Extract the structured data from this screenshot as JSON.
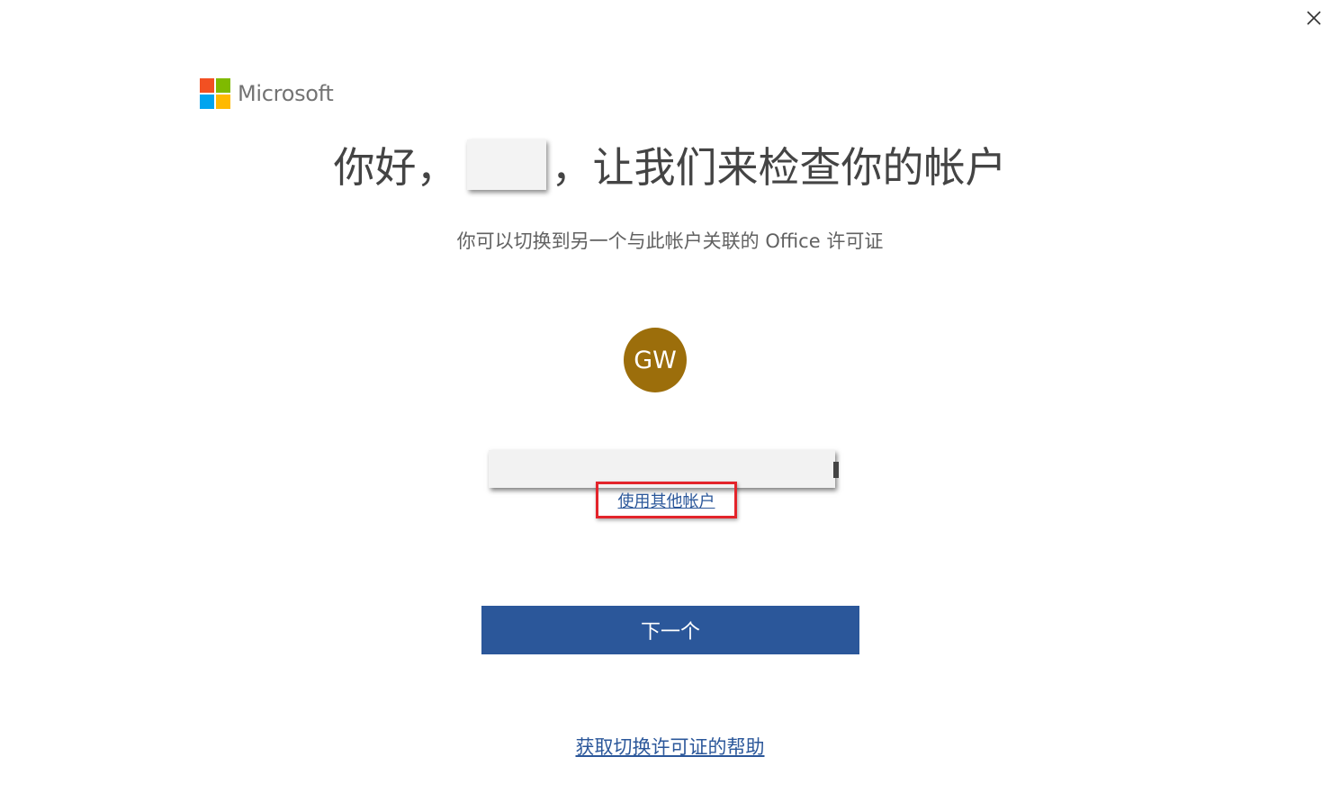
{
  "brand": {
    "name": "Microsoft",
    "logo_colors": [
      "#f25022",
      "#7fba00",
      "#00a4ef",
      "#ffb900"
    ]
  },
  "header": {
    "greeting_prefix": "你好，",
    "greeting_suffix": "，让我们来检查你的帐户"
  },
  "subtitle": "你可以切换到另一个与此帐户关联的 Office 许可证",
  "account": {
    "initials": "GW",
    "avatar_color": "#9c6e0b",
    "use_other_account_label": "使用其他帐户"
  },
  "actions": {
    "next_label": "下一个",
    "help_label": "获取切换许可证的帮助",
    "accent_color": "#2b579a"
  },
  "icons": {
    "close": "close-icon"
  }
}
